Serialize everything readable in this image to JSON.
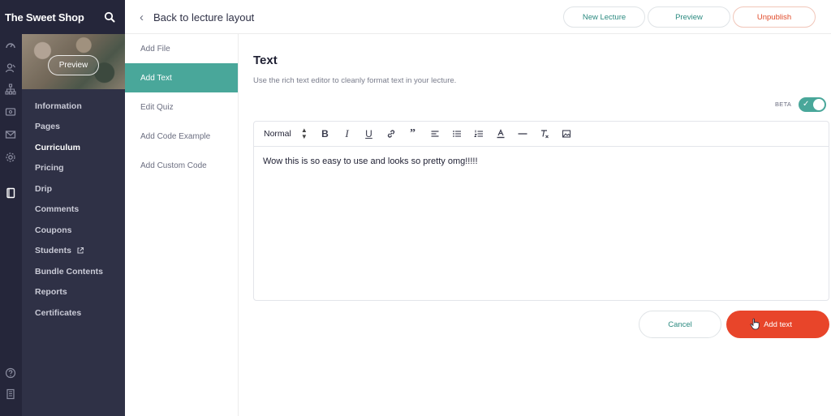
{
  "school": {
    "name": "The Sweet Shop"
  },
  "thumbnail": {
    "preview_label": "Preview"
  },
  "sidebar": {
    "items": [
      {
        "label": "Information"
      },
      {
        "label": "Pages"
      },
      {
        "label": "Curriculum",
        "active": true
      },
      {
        "label": "Pricing"
      },
      {
        "label": "Drip"
      },
      {
        "label": "Comments"
      },
      {
        "label": "Coupons"
      },
      {
        "label": "Students"
      },
      {
        "label": "Bundle Contents"
      },
      {
        "label": "Reports"
      },
      {
        "label": "Certificates"
      }
    ]
  },
  "topbar": {
    "back_label": "Back to lecture layout",
    "new_lecture": "New Lecture",
    "preview": "Preview",
    "unpublish": "Unpublish"
  },
  "submenu": {
    "items": [
      {
        "label": "Add File"
      },
      {
        "label": "Add Text",
        "active": true
      },
      {
        "label": "Edit Quiz"
      },
      {
        "label": "Add Code Example"
      },
      {
        "label": "Add Custom Code"
      }
    ]
  },
  "main": {
    "title": "Text",
    "description": "Use the rich text editor to cleanly format text in your lecture.",
    "beta_label": "BETA",
    "beta_enabled": true
  },
  "editor": {
    "format_value": "Normal",
    "content": "Wow this is so easy to use and looks so pretty omg!!!!!"
  },
  "actions": {
    "cancel": "Cancel",
    "add": "Add text"
  },
  "colors": {
    "sidebar_bg": "#2f3146",
    "accent_teal": "#49a79a",
    "accent_orange": "#e8452a"
  }
}
